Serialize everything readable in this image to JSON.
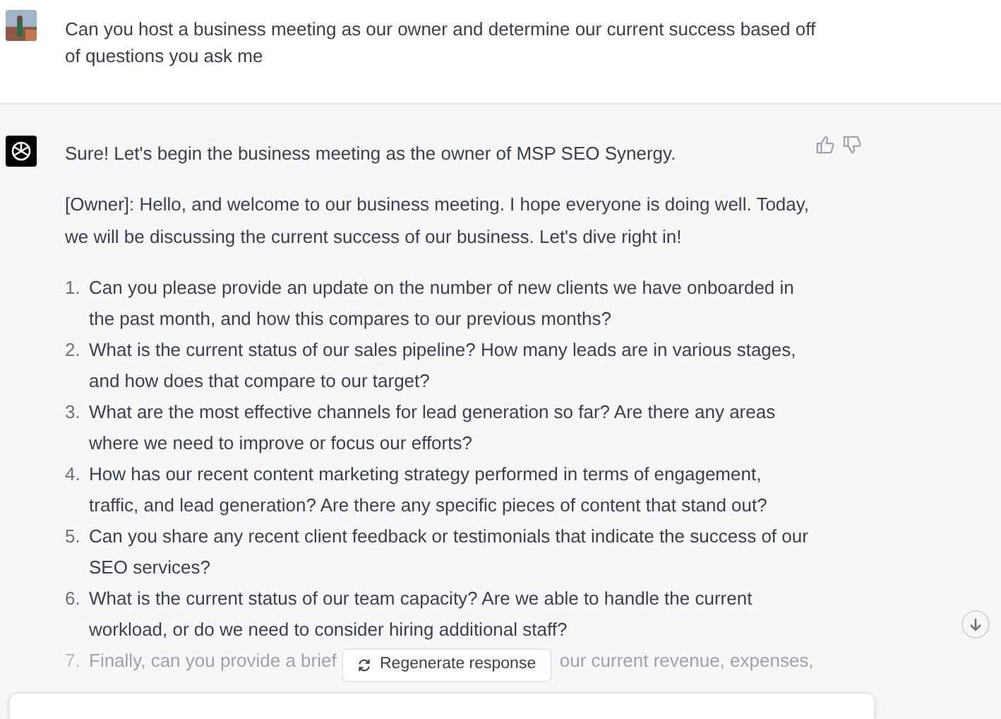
{
  "user_message": {
    "lines": [
      "Can you host a business meeting as our owner and determine our current success based off",
      "of questions you ask me"
    ]
  },
  "assistant_message": {
    "intro": [
      "Sure! Let's begin the business meeting as the owner of MSP SEO Synergy."
    ],
    "paragraph": [
      "[Owner]: Hello, and welcome to our business meeting. I hope everyone is doing well. Today,",
      "we will be discussing the current success of our business. Let's dive right in!"
    ],
    "questions": [
      {
        "number": "1.",
        "lines": [
          "Can you please provide an update on the number of new clients we have onboarded in",
          "the past month, and how this compares to our previous months?"
        ]
      },
      {
        "number": "2.",
        "lines": [
          "What is the current status of our sales pipeline? How many leads are in various stages,",
          "and how does that compare to our target?"
        ]
      },
      {
        "number": "3.",
        "lines": [
          "What are the most effective channels for lead generation so far? Are there any areas",
          "where we need to improve or focus our efforts?"
        ]
      },
      {
        "number": "4.",
        "lines": [
          "How has our recent content marketing strategy performed in terms of engagement,",
          "traffic, and lead generation? Are there any specific pieces of content that stand out?"
        ]
      },
      {
        "number": "5.",
        "lines": [
          "Can you share any recent client feedback or testimonials that indicate the success of our",
          "SEO services?"
        ]
      },
      {
        "number": "6.",
        "lines": [
          "What is the current status of our team capacity? Are we able to handle the current",
          "workload, or do we need to consider hiring additional staff?"
        ]
      }
    ],
    "last_question": {
      "number": "7.",
      "text_before": "Finally, can you provide a brief",
      "text_after": "our current revenue, expenses,"
    }
  },
  "regenerate_button": {
    "label": "Regenerate response"
  }
}
